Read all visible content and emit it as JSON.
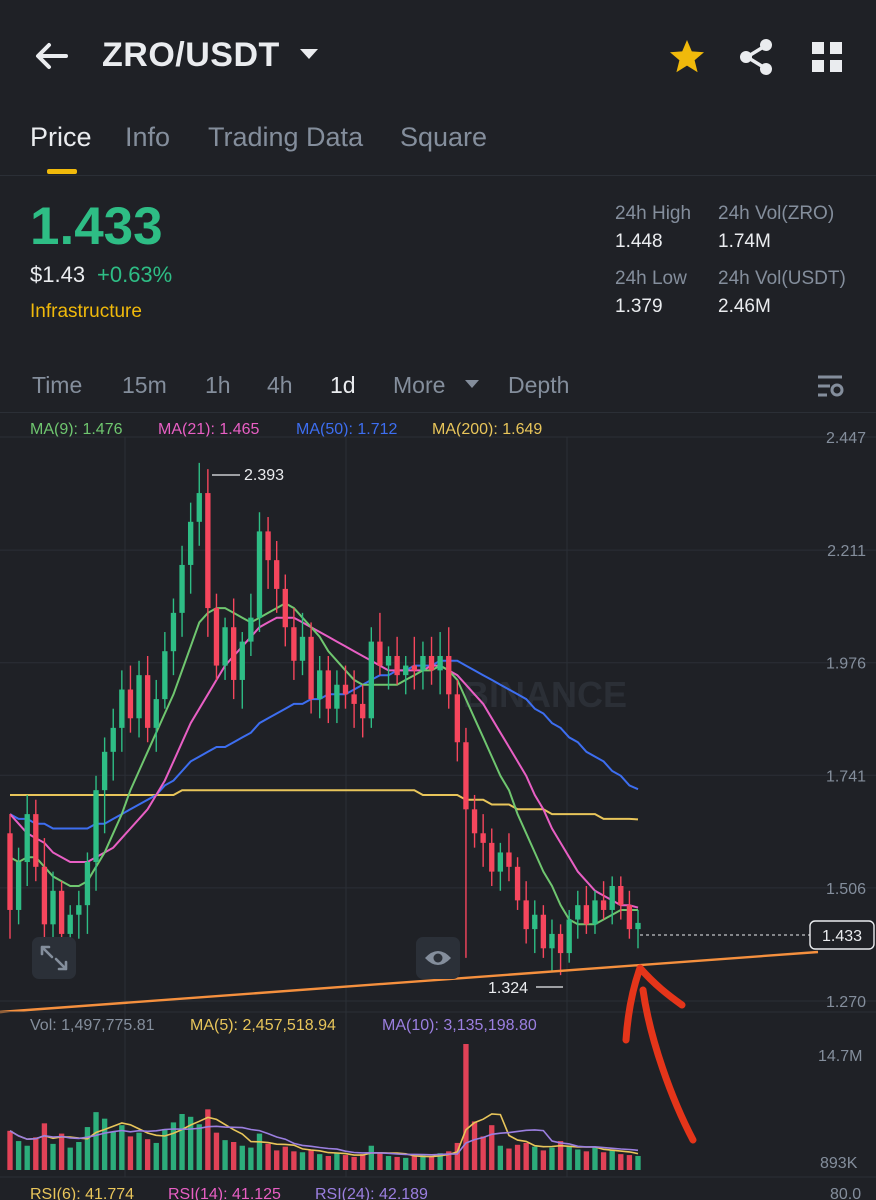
{
  "header": {
    "pair": "ZRO/USDT",
    "icons": [
      "back-arrow-icon",
      "caret-down-icon",
      "star-icon",
      "share-icon",
      "grid-icon"
    ]
  },
  "tabs": [
    {
      "label": "Price",
      "active": true
    },
    {
      "label": "Info"
    },
    {
      "label": "Trading Data"
    },
    {
      "label": "Square"
    }
  ],
  "ticker": {
    "last_price": "1.433",
    "fiat_price": "$1.43",
    "change": "+0.63%",
    "tag": "Infrastructure",
    "high_label": "24h High",
    "high_value": "1.448",
    "vol_base_label": "24h Vol(ZRO)",
    "vol_base_value": "1.74M",
    "low_label": "24h Low",
    "low_value": "1.379",
    "vol_quote_label": "24h Vol(USDT)",
    "vol_quote_value": "2.46M"
  },
  "intervals": {
    "items": [
      "Time",
      "15m",
      "1h",
      "4h",
      "1d",
      "More",
      "Depth"
    ],
    "active": "1d"
  },
  "colors": {
    "up": "#2ebd85",
    "down": "#f6465d",
    "accent": "#f0b90b",
    "ma9": "#6fc66f",
    "ma21": "#e85fc4",
    "ma50": "#3d6ef0",
    "ma200": "#e8c55a",
    "trendline": "#f5903e",
    "annotation": "#e5351a"
  },
  "indicators": {
    "ma9": "MA(9): 1.476",
    "ma21": "MA(21): 1.465",
    "ma50": "MA(50): 1.712",
    "ma200": "MA(200): 1.649",
    "vol": "Vol: 1,497,775.81",
    "vol_ma5": "MA(5): 2,457,518.94",
    "vol_ma10": "MA(10): 3,135,198.80",
    "rsi6": "RSI(6): 41.774",
    "rsi14": "RSI(14): 41.125",
    "rsi24": "RSI(24): 42.189"
  },
  "chart_data": {
    "type": "candlestick",
    "y_ticks": [
      "2.447",
      "2.211",
      "1.976",
      "1.741",
      "1.506",
      "1.270"
    ],
    "ylim": [
      1.27,
      2.447
    ],
    "current_price": "1.433",
    "high_marker": "2.393",
    "low_marker": "1.324",
    "vol_ticks": [
      "14.7M",
      "893K"
    ],
    "rsi_tick": "80.0",
    "watermark": "BINANCE",
    "candles": [
      [
        1.62,
        1.66,
        1.4,
        1.46
      ],
      [
        1.46,
        1.59,
        1.43,
        1.56
      ],
      [
        1.56,
        1.7,
        1.51,
        1.66
      ],
      [
        1.66,
        1.69,
        1.52,
        1.55
      ],
      [
        1.55,
        1.61,
        1.39,
        1.43
      ],
      [
        1.43,
        1.54,
        1.39,
        1.5
      ],
      [
        1.5,
        1.52,
        1.38,
        1.41
      ],
      [
        1.41,
        1.47,
        1.36,
        1.45
      ],
      [
        1.45,
        1.5,
        1.4,
        1.47
      ],
      [
        1.47,
        1.58,
        1.41,
        1.56
      ],
      [
        1.56,
        1.74,
        1.5,
        1.71
      ],
      [
        1.71,
        1.82,
        1.62,
        1.79
      ],
      [
        1.79,
        1.88,
        1.73,
        1.84
      ],
      [
        1.84,
        1.96,
        1.79,
        1.92
      ],
      [
        1.92,
        1.97,
        1.83,
        1.86
      ],
      [
        1.86,
        1.98,
        1.82,
        1.95
      ],
      [
        1.95,
        1.99,
        1.81,
        1.84
      ],
      [
        1.84,
        1.94,
        1.79,
        1.9
      ],
      [
        1.9,
        2.04,
        1.88,
        2.0
      ],
      [
        2.0,
        2.11,
        1.95,
        2.08
      ],
      [
        2.08,
        2.22,
        2.03,
        2.18
      ],
      [
        2.18,
        2.31,
        2.12,
        2.27
      ],
      [
        2.27,
        2.393,
        2.22,
        2.33
      ],
      [
        2.33,
        2.38,
        2.03,
        2.09
      ],
      [
        2.09,
        2.12,
        1.94,
        1.97
      ],
      [
        1.97,
        2.07,
        1.94,
        2.05
      ],
      [
        2.05,
        2.11,
        1.9,
        1.94
      ],
      [
        1.94,
        2.04,
        1.88,
        2.02
      ],
      [
        2.02,
        2.12,
        1.99,
        2.07
      ],
      [
        2.07,
        2.29,
        2.04,
        2.25
      ],
      [
        2.25,
        2.28,
        2.13,
        2.19
      ],
      [
        2.19,
        2.23,
        2.08,
        2.13
      ],
      [
        2.13,
        2.16,
        2.01,
        2.05
      ],
      [
        2.05,
        2.09,
        1.94,
        1.98
      ],
      [
        1.98,
        2.08,
        1.95,
        2.03
      ],
      [
        2.03,
        2.06,
        1.87,
        1.9
      ],
      [
        1.9,
        1.99,
        1.86,
        1.96
      ],
      [
        1.96,
        1.99,
        1.85,
        1.88
      ],
      [
        1.88,
        1.96,
        1.85,
        1.93
      ],
      [
        1.93,
        1.97,
        1.88,
        1.91
      ],
      [
        1.91,
        1.96,
        1.84,
        1.89
      ],
      [
        1.89,
        1.93,
        1.82,
        1.86
      ],
      [
        1.86,
        2.05,
        1.84,
        2.02
      ],
      [
        2.02,
        2.08,
        1.95,
        1.97
      ],
      [
        1.97,
        2.01,
        1.92,
        1.99
      ],
      [
        1.99,
        2.03,
        1.93,
        1.95
      ],
      [
        1.95,
        1.99,
        1.91,
        1.97
      ],
      [
        1.97,
        2.03,
        1.92,
        1.96
      ],
      [
        1.96,
        2.02,
        1.92,
        1.99
      ],
      [
        1.99,
        2.03,
        1.93,
        1.96
      ],
      [
        1.96,
        2.04,
        1.91,
        1.99
      ],
      [
        1.99,
        2.05,
        1.88,
        1.91
      ],
      [
        1.91,
        1.94,
        1.77,
        1.81
      ],
      [
        1.81,
        1.84,
        1.36,
        1.67
      ],
      [
        1.67,
        1.7,
        1.59,
        1.62
      ],
      [
        1.62,
        1.66,
        1.55,
        1.6
      ],
      [
        1.6,
        1.63,
        1.51,
        1.54
      ],
      [
        1.54,
        1.6,
        1.5,
        1.58
      ],
      [
        1.58,
        1.62,
        1.52,
        1.55
      ],
      [
        1.55,
        1.57,
        1.46,
        1.48
      ],
      [
        1.48,
        1.52,
        1.39,
        1.42
      ],
      [
        1.42,
        1.48,
        1.37,
        1.45
      ],
      [
        1.45,
        1.47,
        1.36,
        1.38
      ],
      [
        1.38,
        1.44,
        1.33,
        1.41
      ],
      [
        1.41,
        1.43,
        1.324,
        1.37
      ],
      [
        1.37,
        1.46,
        1.35,
        1.44
      ],
      [
        1.44,
        1.5,
        1.4,
        1.47
      ],
      [
        1.47,
        1.51,
        1.41,
        1.43
      ],
      [
        1.43,
        1.5,
        1.41,
        1.48
      ],
      [
        1.48,
        1.52,
        1.44,
        1.46
      ],
      [
        1.46,
        1.53,
        1.43,
        1.51
      ],
      [
        1.51,
        1.53,
        1.44,
        1.47
      ],
      [
        1.47,
        1.5,
        1.4,
        1.42
      ],
      [
        1.42,
        1.46,
        1.38,
        1.433
      ]
    ],
    "ma9": [
      1.57,
      1.56,
      1.57,
      1.57,
      1.55,
      1.53,
      1.52,
      1.51,
      1.51,
      1.52,
      1.55,
      1.58,
      1.62,
      1.66,
      1.71,
      1.75,
      1.79,
      1.83,
      1.87,
      1.91,
      1.96,
      2.01,
      2.06,
      2.08,
      2.09,
      2.09,
      2.08,
      2.07,
      2.06,
      2.07,
      2.08,
      2.09,
      2.1,
      2.09,
      2.07,
      2.05,
      2.03,
      2.0,
      1.98,
      1.96,
      1.94,
      1.93,
      1.93,
      1.93,
      1.93,
      1.93,
      1.94,
      1.95,
      1.96,
      1.96,
      1.97,
      1.96,
      1.94,
      1.9,
      1.86,
      1.82,
      1.78,
      1.74,
      1.71,
      1.66,
      1.62,
      1.58,
      1.54,
      1.51,
      1.47,
      1.44,
      1.43,
      1.43,
      1.43,
      1.44,
      1.45,
      1.46,
      1.46,
      1.46
    ],
    "ma21": [
      1.66,
      1.64,
      1.62,
      1.61,
      1.6,
      1.58,
      1.57,
      1.56,
      1.56,
      1.56,
      1.57,
      1.58,
      1.59,
      1.61,
      1.63,
      1.65,
      1.67,
      1.7,
      1.73,
      1.77,
      1.81,
      1.85,
      1.88,
      1.91,
      1.94,
      1.97,
      1.99,
      2.01,
      2.03,
      2.05,
      2.06,
      2.07,
      2.07,
      2.07,
      2.06,
      2.05,
      2.04,
      2.03,
      2.02,
      2.01,
      2.0,
      1.99,
      1.98,
      1.97,
      1.96,
      1.96,
      1.96,
      1.96,
      1.96,
      1.97,
      1.97,
      1.96,
      1.95,
      1.93,
      1.91,
      1.89,
      1.86,
      1.83,
      1.8,
      1.77,
      1.74,
      1.7,
      1.67,
      1.63,
      1.6,
      1.57,
      1.54,
      1.52,
      1.5,
      1.49,
      1.48,
      1.47,
      1.47,
      1.465
    ],
    "ma50": [
      1.66,
      1.65,
      1.65,
      1.64,
      1.64,
      1.63,
      1.63,
      1.63,
      1.63,
      1.63,
      1.64,
      1.64,
      1.65,
      1.66,
      1.67,
      1.68,
      1.69,
      1.7,
      1.72,
      1.73,
      1.75,
      1.77,
      1.78,
      1.79,
      1.8,
      1.8,
      1.81,
      1.82,
      1.83,
      1.85,
      1.86,
      1.87,
      1.88,
      1.89,
      1.89,
      1.9,
      1.9,
      1.91,
      1.91,
      1.91,
      1.92,
      1.93,
      1.94,
      1.95,
      1.95,
      1.96,
      1.96,
      1.97,
      1.97,
      1.97,
      1.98,
      1.98,
      1.98,
      1.97,
      1.96,
      1.95,
      1.94,
      1.93,
      1.92,
      1.91,
      1.9,
      1.88,
      1.87,
      1.85,
      1.84,
      1.82,
      1.81,
      1.79,
      1.78,
      1.77,
      1.75,
      1.74,
      1.72,
      1.712
    ],
    "ma200": [
      1.7,
      1.7,
      1.7,
      1.7,
      1.7,
      1.7,
      1.7,
      1.7,
      1.7,
      1.7,
      1.7,
      1.7,
      1.7,
      1.7,
      1.7,
      1.7,
      1.7,
      1.7,
      1.7,
      1.7,
      1.71,
      1.71,
      1.71,
      1.71,
      1.71,
      1.71,
      1.71,
      1.71,
      1.71,
      1.71,
      1.71,
      1.71,
      1.71,
      1.71,
      1.71,
      1.71,
      1.71,
      1.71,
      1.71,
      1.71,
      1.71,
      1.71,
      1.71,
      1.71,
      1.71,
      1.71,
      1.71,
      1.71,
      1.7,
      1.7,
      1.7,
      1.7,
      1.7,
      1.69,
      1.69,
      1.69,
      1.68,
      1.68,
      1.68,
      1.67,
      1.67,
      1.67,
      1.67,
      1.66,
      1.66,
      1.66,
      1.66,
      1.66,
      1.66,
      1.65,
      1.65,
      1.65,
      1.65,
      1.649
    ],
    "volume": [
      4.2,
      3.1,
      2.6,
      3.5,
      5.0,
      2.8,
      3.9,
      2.4,
      3.0,
      4.6,
      6.2,
      5.5,
      4.1,
      4.8,
      3.6,
      4.0,
      3.3,
      2.9,
      4.4,
      5.1,
      6.0,
      5.7,
      4.9,
      6.5,
      4.0,
      3.2,
      3.0,
      2.6,
      2.4,
      3.9,
      2.8,
      2.1,
      2.5,
      2.0,
      1.9,
      2.2,
      1.7,
      1.5,
      1.8,
      1.6,
      1.4,
      1.7,
      2.6,
      1.9,
      1.5,
      1.4,
      1.3,
      1.5,
      1.6,
      1.4,
      1.8,
      2.0,
      2.9,
      13.5,
      5.2,
      3.6,
      4.8,
      2.6,
      2.3,
      2.7,
      2.9,
      2.5,
      2.1,
      2.4,
      3.1,
      2.6,
      2.2,
      2.0,
      2.4,
      1.9,
      2.1,
      1.7,
      1.6,
      1.5
    ]
  }
}
